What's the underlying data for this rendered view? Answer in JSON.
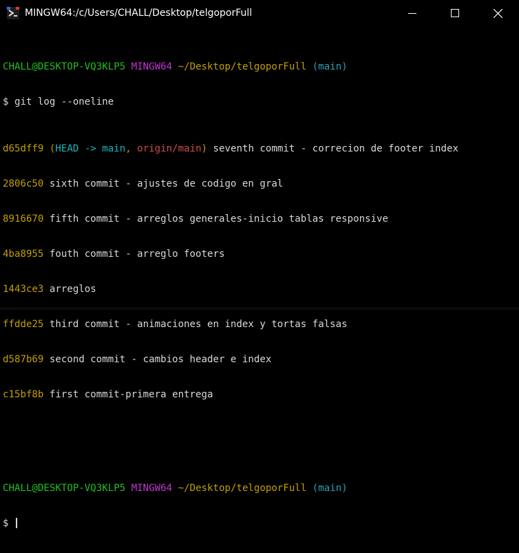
{
  "window": {
    "title": "MINGW64:/c/Users/CHALL/Desktop/telgoporFull"
  },
  "terminal": {
    "prompt1": {
      "userhost": "CHALL@DESKTOP-VQ3KLP5",
      "env": "MINGW64",
      "path": "~/Desktop/telgoporFull",
      "branch": "(main)"
    },
    "command": "$ git log --oneline",
    "commits": [
      {
        "hash": "d65dff9",
        "refs_open": "(",
        "head": "HEAD -> main",
        "sep": ", ",
        "origin": "origin/main",
        "refs_close": ")",
        "message": " seventh commit - correcion de footer index"
      },
      {
        "hash": "2806c50",
        "message": " sixth commit - ajustes de codigo en gral"
      },
      {
        "hash": "8916670",
        "message": " fifth commit - arreglos generales-inicio tablas responsive"
      },
      {
        "hash": "4ba8955",
        "message": " fouth commit - arreglo footers"
      },
      {
        "hash": "1443ce3",
        "message": " arreglos"
      },
      {
        "hash": "ffdde25",
        "message": " third commit - animaciones en index y tortas falsas"
      },
      {
        "hash": "d587b69",
        "message": " second commit - cambios header e index"
      },
      {
        "hash": "c15bf8b",
        "message": " first commit-primera entrega"
      }
    ],
    "prompt2": {
      "userhost": "CHALL@DESKTOP-VQ3KLP5",
      "env": "MINGW64",
      "path": "~/Desktop/telgoporFull",
      "branch": "(main)"
    },
    "input_prompt": "$ "
  },
  "icons": {
    "app": "mingw-terminal-icon",
    "minimize": "minimize-icon",
    "maximize": "maximize-icon",
    "close": "close-icon"
  },
  "colors": {
    "background": "#000000",
    "prompt_green": "#1fc11f",
    "env_magenta": "#c334d3",
    "path_yellow": "#c2a000",
    "branch_cyan": "#2aa1b3",
    "head_teal": "#1cb6b8",
    "origin_red": "#d14b4b",
    "text": "#d9d9d9"
  }
}
